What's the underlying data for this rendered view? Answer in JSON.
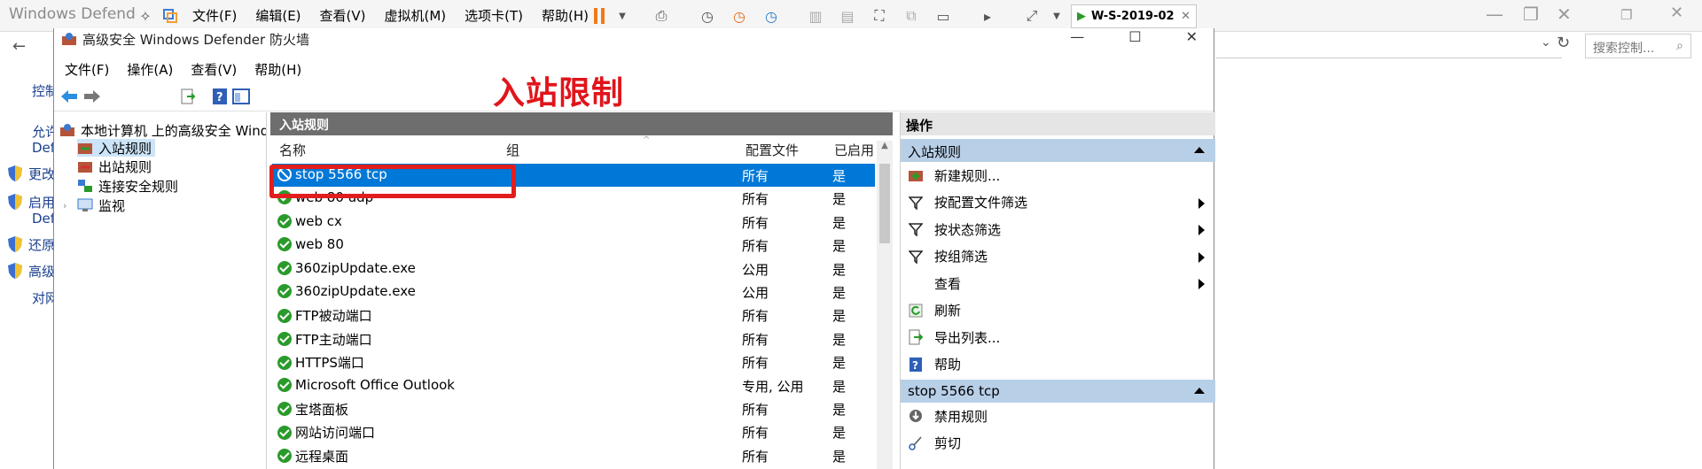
{
  "vmware": {
    "title": "Windows Defender",
    "menu": [
      "文件(F)",
      "编辑(E)",
      "查看(V)",
      "虚拟机(M)",
      "选项卡(T)",
      "帮助(H)"
    ],
    "tab_label": "W-S-2019-02"
  },
  "control_panel": {
    "search_placeholder": "搜索控制...",
    "sidebar": [
      {
        "label": "控制",
        "icon": ""
      },
      {
        "label": "允许",
        "icon": ""
      },
      {
        "label": "Def",
        "icon": ""
      },
      {
        "label": "更改",
        "icon": "shield-icon"
      },
      {
        "label": "启用",
        "icon": "shield-icon"
      },
      {
        "label": "Def",
        "icon": ""
      },
      {
        "label": "还原",
        "icon": "shield-icon"
      },
      {
        "label": "高级",
        "icon": "shield-icon"
      },
      {
        "label": "对网",
        "icon": ""
      }
    ]
  },
  "mmc": {
    "title": "高级安全 Windows Defender 防火墙",
    "menu": [
      "文件(F)",
      "操作(A)",
      "查看(V)",
      "帮助(H)"
    ],
    "tree": {
      "root": "本地计算机 上的高级安全 Windows Defender 防火墙",
      "items": [
        "入站规则",
        "出站规则",
        "连接安全规则",
        "监视"
      ]
    },
    "center": {
      "header": "入站规则",
      "columns": {
        "name": "名称",
        "group": "组",
        "profile": "配置文件",
        "enabled": "已启用"
      },
      "rules": [
        {
          "name": "stop 5566 tcp",
          "profile": "所有",
          "enabled": "是",
          "status": "blocked",
          "selected": true
        },
        {
          "name": "web 80 udp",
          "profile": "所有",
          "enabled": "是",
          "status": "allowed"
        },
        {
          "name": "web cx",
          "profile": "所有",
          "enabled": "是",
          "status": "allowed"
        },
        {
          "name": "web 80",
          "profile": "所有",
          "enabled": "是",
          "status": "allowed"
        },
        {
          "name": "360zipUpdate.exe",
          "profile": "公用",
          "enabled": "是",
          "status": "allowed"
        },
        {
          "name": "360zipUpdate.exe",
          "profile": "公用",
          "enabled": "是",
          "status": "allowed"
        },
        {
          "name": "FTP被动端口",
          "profile": "所有",
          "enabled": "是",
          "status": "allowed"
        },
        {
          "name": "FTP主动端口",
          "profile": "所有",
          "enabled": "是",
          "status": "allowed"
        },
        {
          "name": "HTTPS端口",
          "profile": "所有",
          "enabled": "是",
          "status": "allowed"
        },
        {
          "name": "Microsoft Office Outlook",
          "profile": "专用, 公用",
          "enabled": "是",
          "status": "allowed"
        },
        {
          "name": "宝塔面板",
          "profile": "所有",
          "enabled": "是",
          "status": "allowed"
        },
        {
          "name": "网站访问端口",
          "profile": "所有",
          "enabled": "是",
          "status": "allowed"
        },
        {
          "name": "远程桌面",
          "profile": "所有",
          "enabled": "是",
          "status": "allowed"
        }
      ]
    },
    "actions": {
      "header": "操作",
      "section1": "入站规则",
      "section1_items": [
        {
          "label": "新建规则...",
          "icon": "new-rule-icon",
          "submenu": false
        },
        {
          "label": "按配置文件筛选",
          "icon": "filter-icon",
          "submenu": true
        },
        {
          "label": "按状态筛选",
          "icon": "filter-icon",
          "submenu": true
        },
        {
          "label": "按组筛选",
          "icon": "filter-icon",
          "submenu": true
        },
        {
          "label": "查看",
          "icon": "",
          "submenu": true
        },
        {
          "label": "刷新",
          "icon": "refresh-icon",
          "submenu": false
        },
        {
          "label": "导出列表...",
          "icon": "export-icon",
          "submenu": false
        },
        {
          "label": "帮助",
          "icon": "help-icon",
          "submenu": false
        }
      ],
      "section2": "stop 5566 tcp",
      "section2_items": [
        {
          "label": "禁用规则",
          "icon": "disable-rule-icon",
          "submenu": false
        },
        {
          "label": "剪切",
          "icon": "cut-icon",
          "submenu": false
        }
      ]
    }
  },
  "annotation": "入站限制",
  "colors": {
    "accent": "#0078d7",
    "annotation": "#e0151b",
    "section": "#b8cfe8"
  }
}
